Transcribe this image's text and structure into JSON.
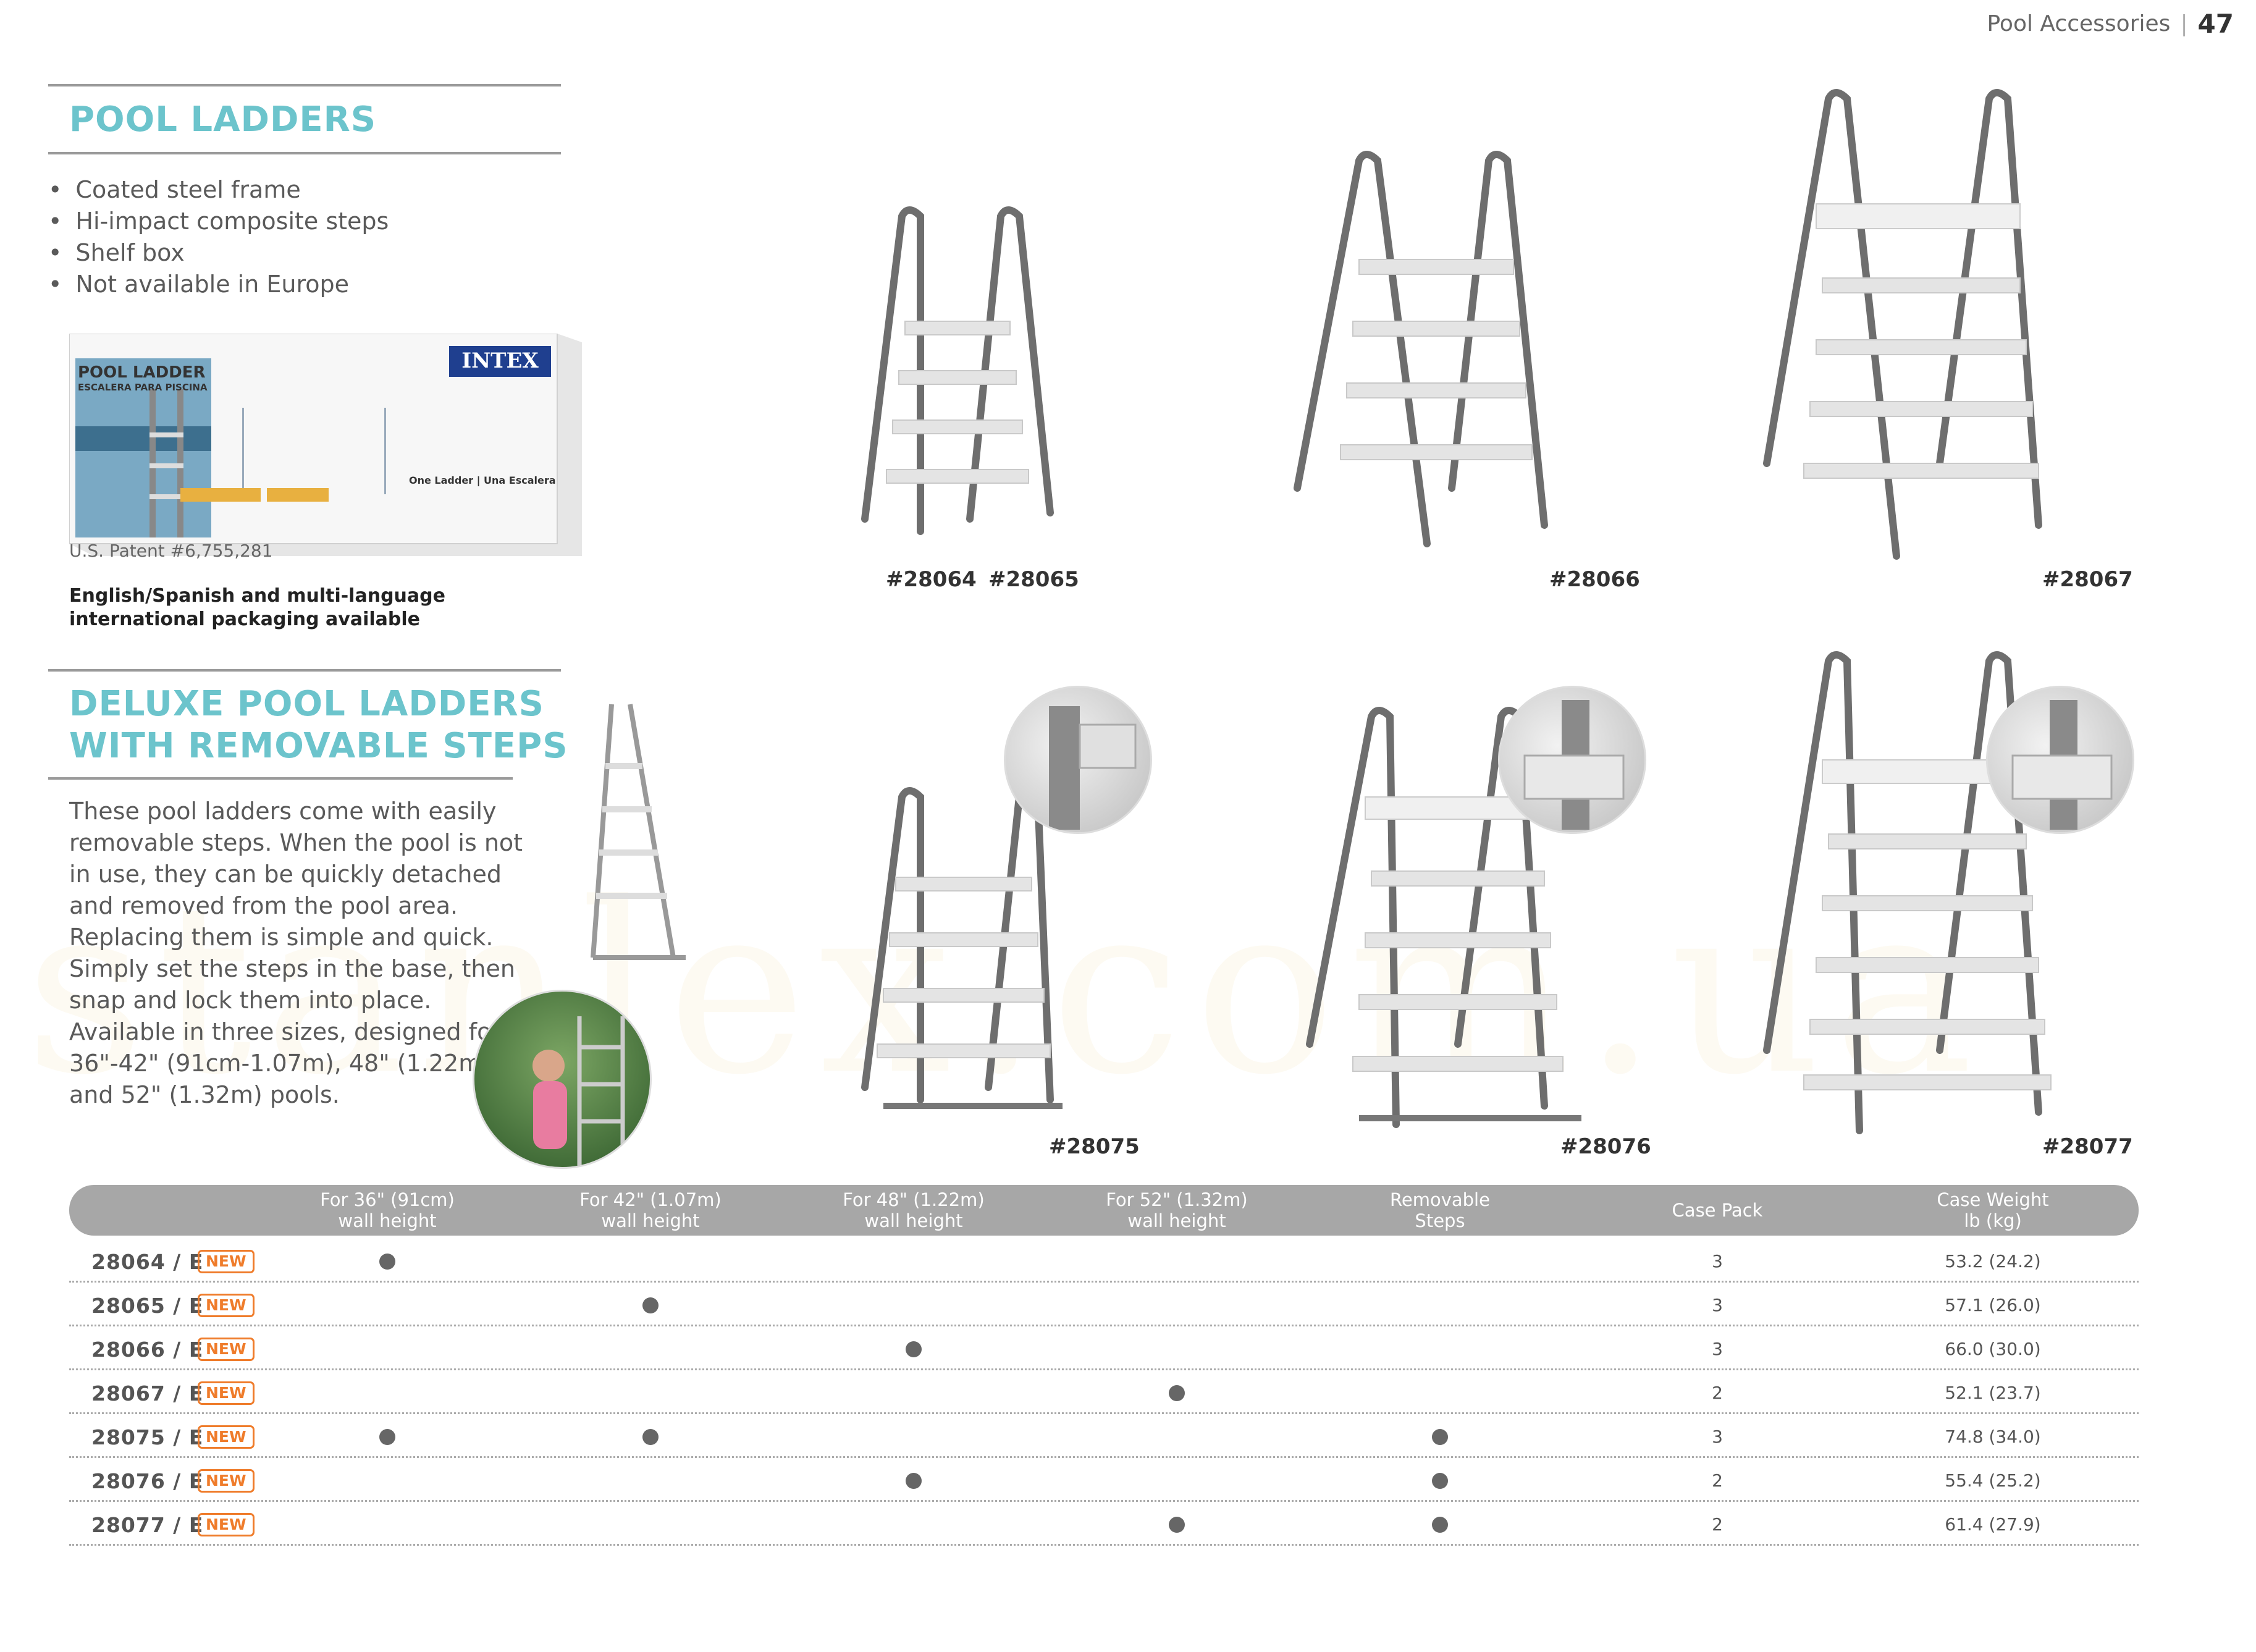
{
  "header": {
    "section": "Pool Accessories",
    "separator": "|",
    "page_number": "47"
  },
  "pool_ladders": {
    "title": "POOL LADDERS",
    "features": [
      "Coated steel frame",
      "Hi-impact composite steps",
      "Shelf box",
      "Not available in Europe"
    ],
    "box": {
      "title": "POOL LADDER",
      "subtitle": "ESCALERA PARA PISCINA",
      "brand": "INTEX",
      "label": "One Ladder | Una Escalera"
    },
    "patent": "U.S. Patent #6,755,281",
    "packaging_note": [
      "English/Spanish and multi-language",
      "international packaging available"
    ]
  },
  "deluxe": {
    "title_lines": [
      "DELUXE POOL LADDERS",
      "WITH REMOVABLE STEPS"
    ],
    "description": "These pool ladders come with easily removable steps. When the pool is not in use, they can be quickly detached and removed from the pool area. Replacing them is simple and quick. Simply set the steps in the base, then snap and lock them into place. Available in three sizes, designed for 36\"-42\" (91cm-1.07m), 48\" (1.22m) and 52\" (1.32m) pools."
  },
  "product_labels": {
    "p28064": "#28064",
    "p28065": "#28065",
    "p28066": "#28066",
    "p28067": "#28067",
    "p28075": "#28075",
    "p28076": "#28076",
    "p28077": "#28077"
  },
  "table": {
    "headers": [
      [
        "For 36\" (91cm)",
        "wall height"
      ],
      [
        "For 42\" (1.07m)",
        "wall height"
      ],
      [
        "For 48\" (1.22m)",
        "wall height"
      ],
      [
        "For 52\" (1.32m)",
        "wall height"
      ],
      [
        "Removable",
        "Steps"
      ],
      [
        "Case Pack",
        ""
      ],
      [
        "Case Weight",
        "lb (kg)"
      ]
    ],
    "badge_text": "NEW",
    "rows": [
      {
        "code": "28064 / E",
        "w36": true,
        "w42": false,
        "w48": false,
        "w52": false,
        "removable": false,
        "case_pack": "3",
        "weight": "53.2 (24.2)"
      },
      {
        "code": "28065 / E",
        "w36": false,
        "w42": true,
        "w48": false,
        "w52": false,
        "removable": false,
        "case_pack": "3",
        "weight": "57.1 (26.0)"
      },
      {
        "code": "28066 / E",
        "w36": false,
        "w42": false,
        "w48": true,
        "w52": false,
        "removable": false,
        "case_pack": "3",
        "weight": "66.0 (30.0)"
      },
      {
        "code": "28067 / E",
        "w36": false,
        "w42": false,
        "w48": false,
        "w52": true,
        "removable": false,
        "case_pack": "2",
        "weight": "52.1 (23.7)"
      },
      {
        "code": "28075 / E",
        "w36": true,
        "w42": true,
        "w48": false,
        "w52": false,
        "removable": true,
        "case_pack": "3",
        "weight": "74.8 (34.0)"
      },
      {
        "code": "28076 / E",
        "w36": false,
        "w42": false,
        "w48": true,
        "w52": false,
        "removable": true,
        "case_pack": "2",
        "weight": "55.4 (25.2)"
      },
      {
        "code": "28077 / E",
        "w36": false,
        "w42": false,
        "w48": false,
        "w52": true,
        "removable": true,
        "case_pack": "2",
        "weight": "61.4 (27.9)"
      }
    ]
  },
  "watermark": "stanlex.com.ua",
  "colors": {
    "accent": "#6cc4cc",
    "badge": "#ef7c2b",
    "table_header": "#a7a7a7",
    "dot": "#666666"
  }
}
